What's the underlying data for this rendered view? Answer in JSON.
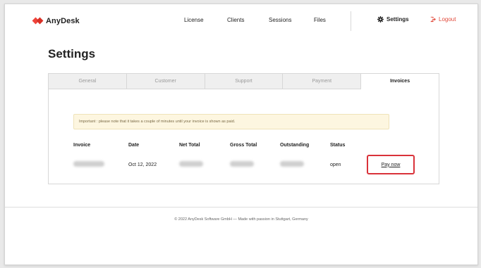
{
  "brand": {
    "name": "AnyDesk",
    "accent_color": "#ef443b"
  },
  "nav": {
    "links": [
      "License",
      "Clients",
      "Sessions",
      "Files"
    ],
    "settings_label": "Settings",
    "settings_icon": "gear-icon",
    "logout_label": "Logout",
    "logout_icon": "logout-icon"
  },
  "page": {
    "title": "Settings"
  },
  "tabs": [
    {
      "label": "General",
      "active": false
    },
    {
      "label": "Customer",
      "active": false
    },
    {
      "label": "Support",
      "active": false
    },
    {
      "label": "Payment",
      "active": false
    },
    {
      "label": "Invoices",
      "active": true
    }
  ],
  "notice": "Important : please note that it takes a couple of minutes until your invoice is shown as paid.",
  "invoices": {
    "columns": [
      "Invoice",
      "Date",
      "Net Total",
      "Gross Total",
      "Outstanding",
      "Status"
    ],
    "rows": [
      {
        "date": "Oct 12, 2022",
        "status": "open",
        "action": "Pay now"
      }
    ]
  },
  "footer": "© 2022 AnyDesk Software GmbH — Made with passion in Stuttgart, Germany"
}
